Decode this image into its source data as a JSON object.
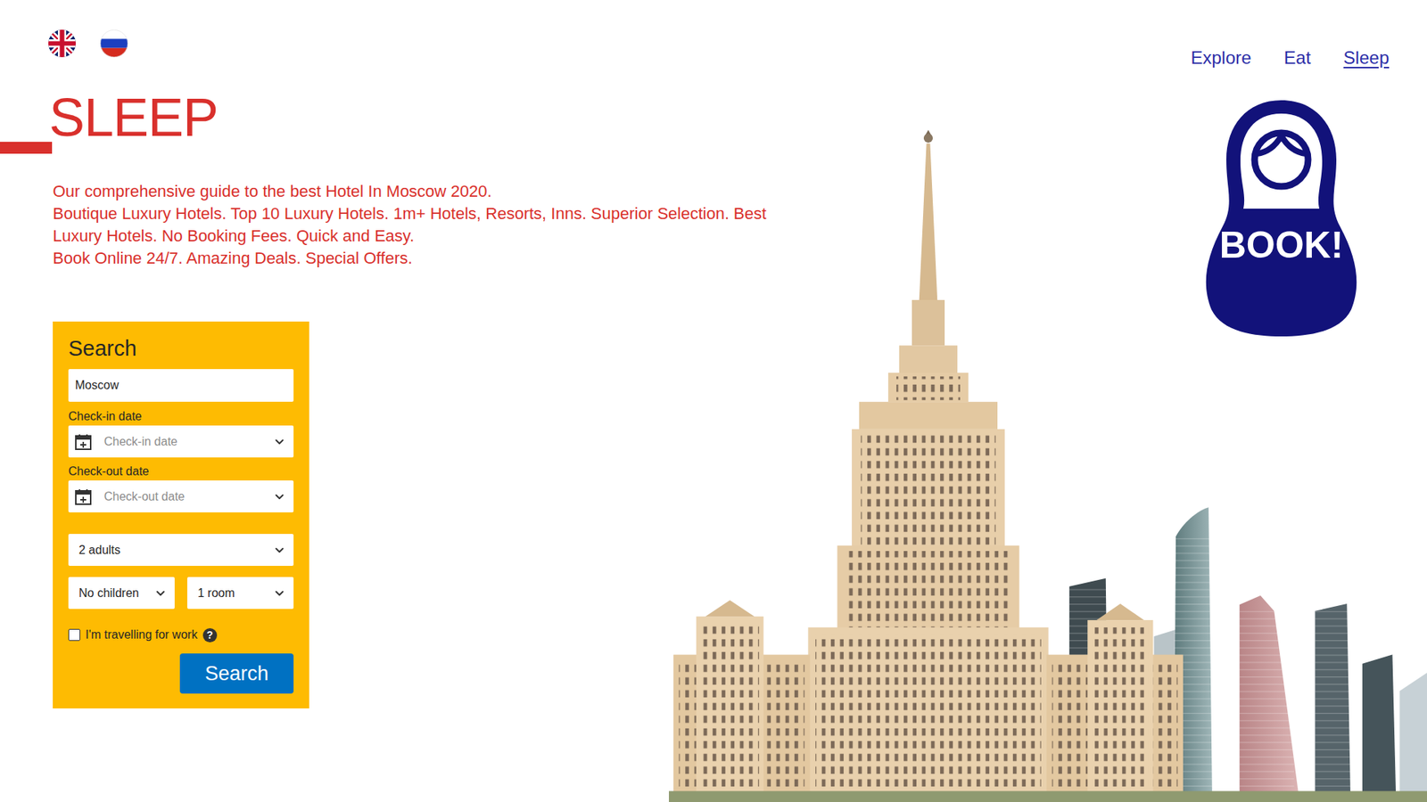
{
  "nav": [
    {
      "label": "Explore",
      "selected": false
    },
    {
      "label": "Eat",
      "selected": false
    },
    {
      "label": "Sleep",
      "selected": true
    }
  ],
  "page": {
    "title": "SLEEP",
    "description": [
      "Our comprehensive guide to the best Hotel In Moscow 2020.",
      "Boutique Luxury Hotels. Top 10 Luxury Hotels. 1m+ Hotels, Resorts, Inns. Superior Selection. Best",
      "Luxury Hotels. No Booking Fees. Quick and Easy.",
      "Book Online 24/7. Amazing Deals. Special Offers."
    ]
  },
  "logo": {
    "label": "BOOK!"
  },
  "search": {
    "title": "Search",
    "destination": "Moscow",
    "checkin": {
      "label": "Check-in date",
      "placeholder": "Check-in date"
    },
    "checkout": {
      "label": "Check-out date",
      "placeholder": "Check-out date"
    },
    "adults": "2 adults",
    "children": "No children",
    "rooms": "1 room",
    "work_travel": {
      "label": "I'm travelling for work",
      "checked": false,
      "help": "?"
    },
    "button": "Search"
  }
}
